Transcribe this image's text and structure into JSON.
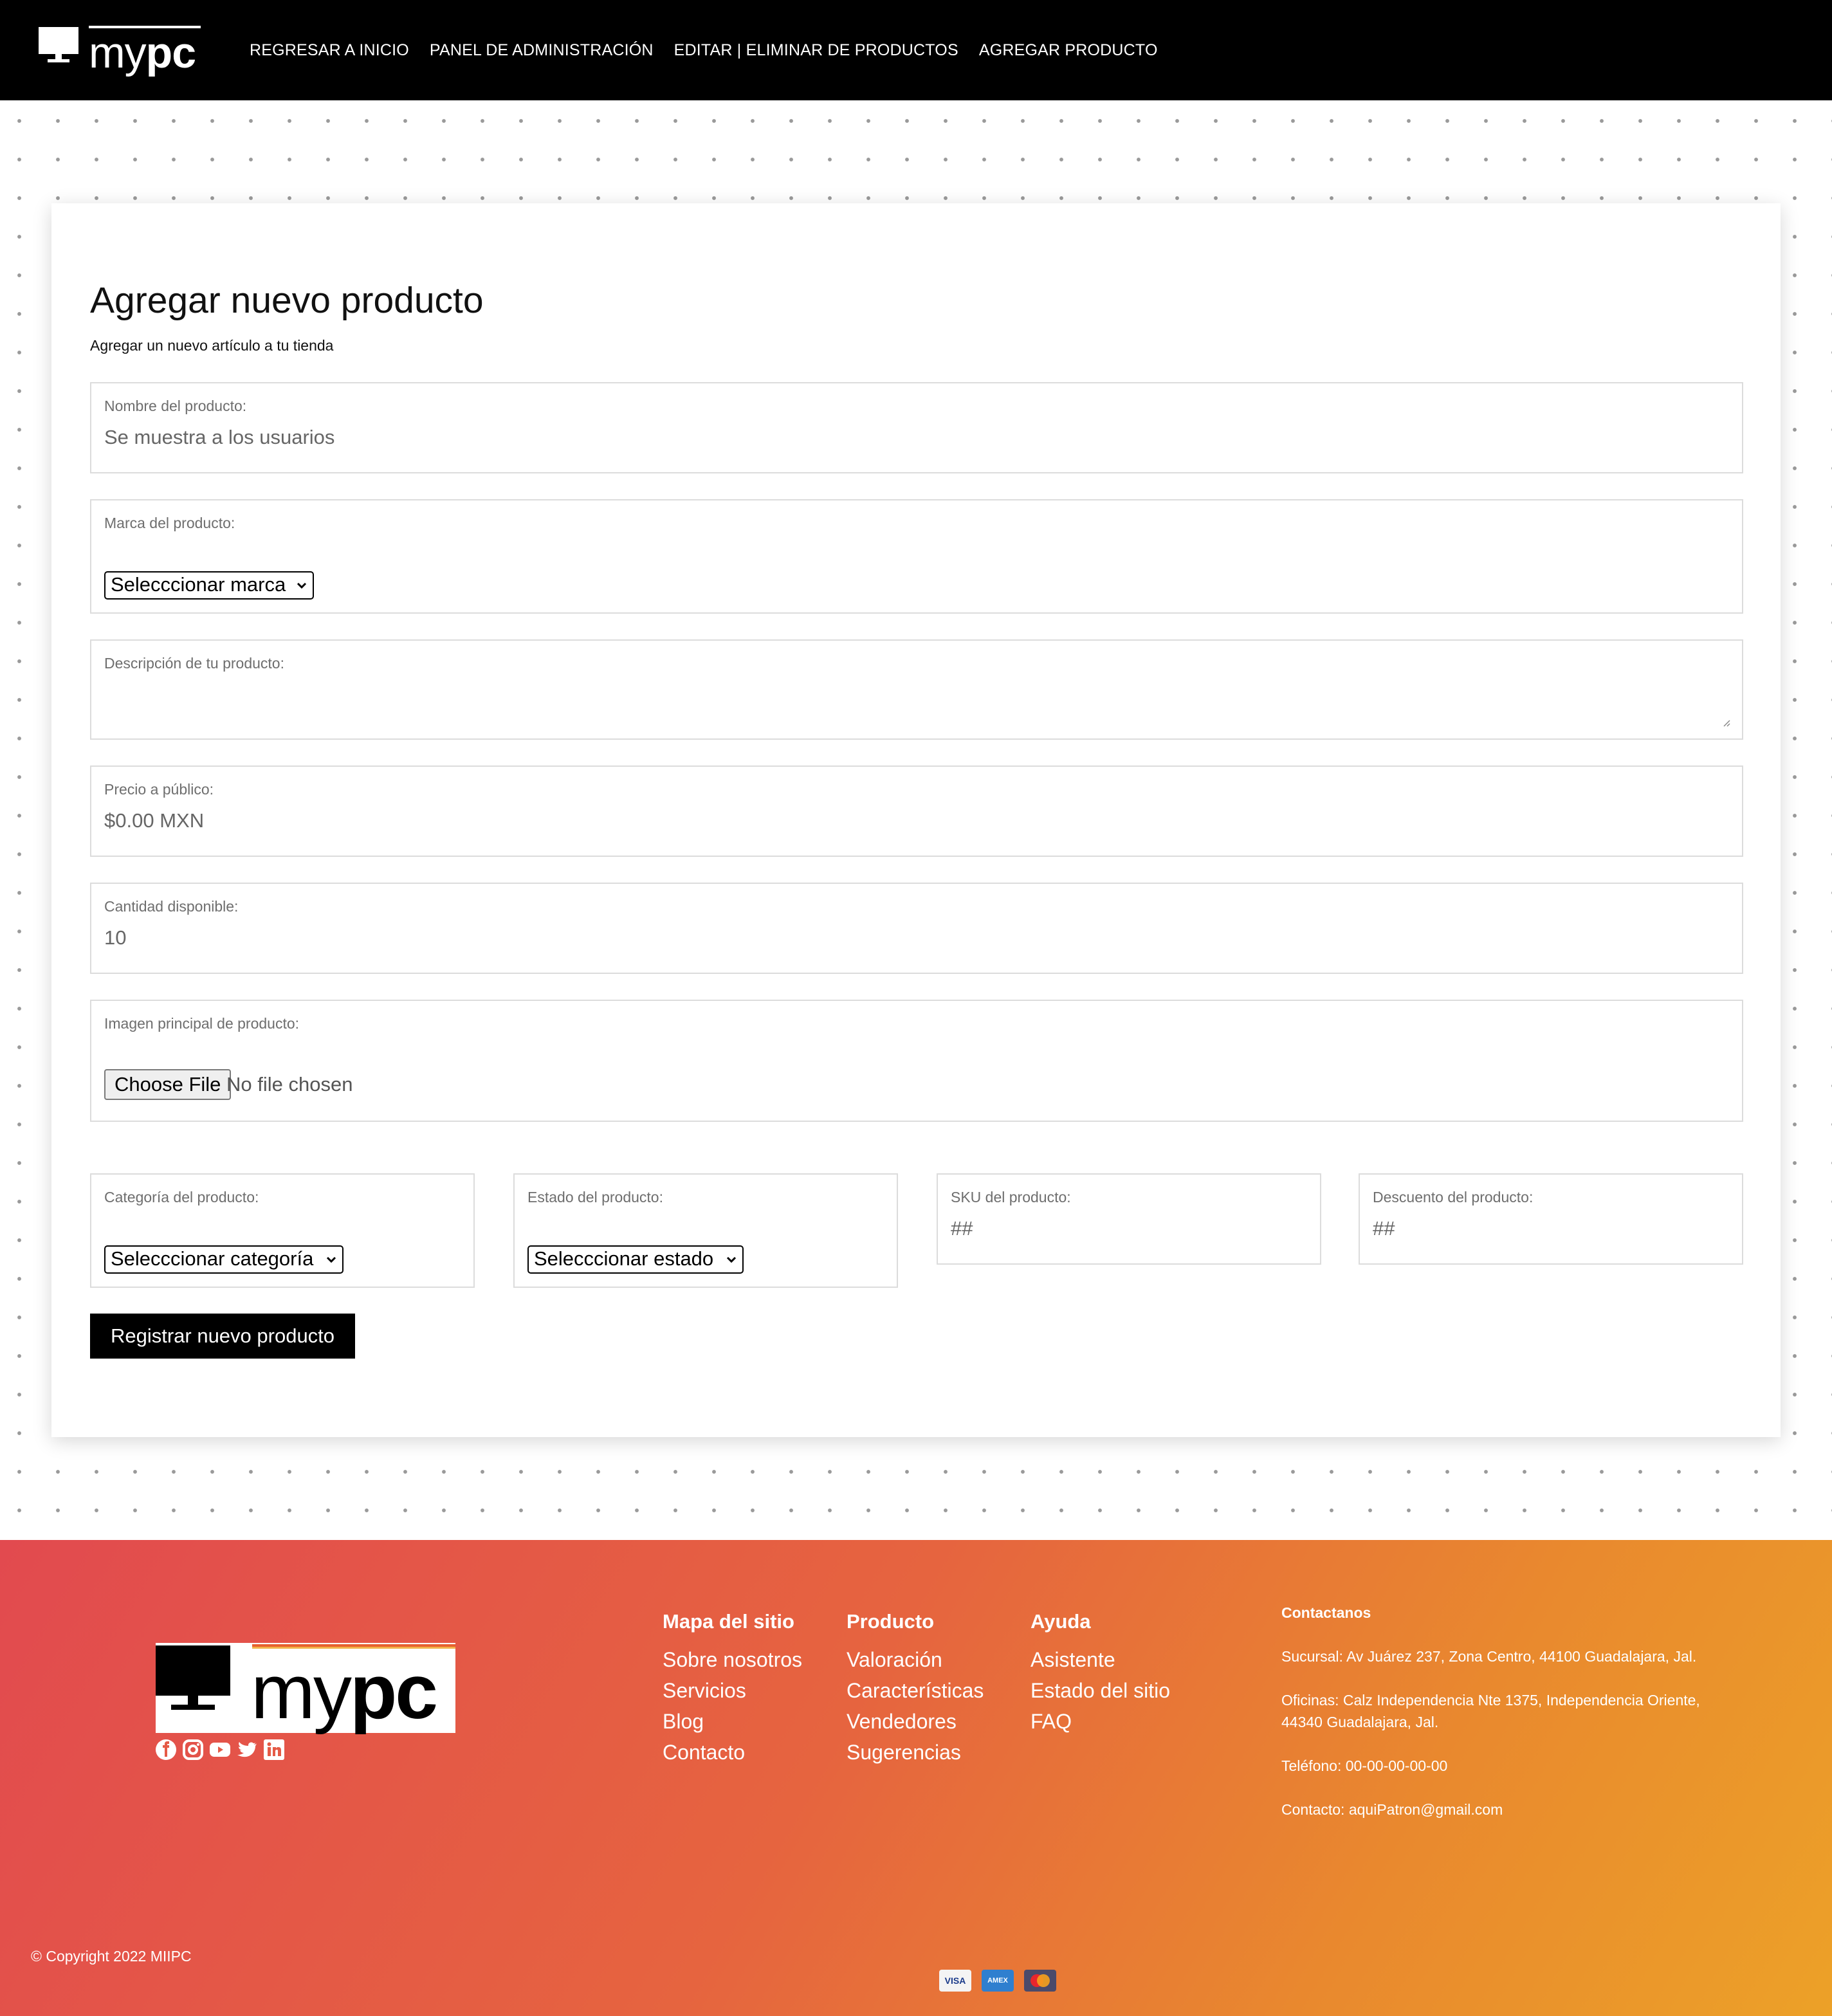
{
  "header": {
    "brand": {
      "my": "my",
      "pc": "pc"
    },
    "nav": [
      "REGRESAR A INICIO",
      "PANEL DE ADMINISTRACIÓN",
      "EDITAR | ELIMINAR DE PRODUCTOS",
      "AGREGAR PRODUCTO"
    ]
  },
  "form": {
    "title": "Agregar nuevo producto",
    "subtitle": "Agregar un nuevo artículo a tu tienda",
    "name": {
      "label": "Nombre del producto:",
      "placeholder": "Se muestra a los usuarios"
    },
    "brand": {
      "label": "Marca del producto:",
      "selected": "Selecccionar marca"
    },
    "description": {
      "label": "Descripción de tu producto:"
    },
    "price": {
      "label": "Precio a público:",
      "placeholder": "$0.00 MXN"
    },
    "quantity": {
      "label": "Cantidad disponible:",
      "placeholder": "10"
    },
    "image": {
      "label": "Imagen principal de producto:",
      "button": "Choose File",
      "status": "No file chosen"
    },
    "category": {
      "label": "Categoría del producto:",
      "selected": "Selecccionar categoría"
    },
    "state": {
      "label": "Estado del producto:",
      "selected": "Selecccionar estado"
    },
    "sku": {
      "label": "SKU del producto:",
      "placeholder": "##"
    },
    "discount": {
      "label": "Descuento del producto:",
      "placeholder": "##"
    },
    "submit": "Registrar nuevo producto"
  },
  "footer": {
    "logo": {
      "my": "my",
      "pc": "pc"
    },
    "socials": [
      "facebook-icon",
      "instagram-icon",
      "youtube-icon",
      "twitter-icon",
      "linkedin-icon"
    ],
    "columns": [
      {
        "title": "Mapa del sitio",
        "links": [
          "Sobre nosotros",
          "Servicios",
          "Blog",
          "Contacto"
        ]
      },
      {
        "title": "Producto",
        "links": [
          "Valoración",
          "Características",
          "Vendedores",
          "Sugerencias"
        ]
      },
      {
        "title": "Ayuda",
        "links": [
          "Asistente",
          "Estado del sitio",
          "FAQ"
        ]
      }
    ],
    "contact": {
      "title": "Contactanos",
      "lines": [
        "Sucursal: Av Juárez 237, Zona Centro, 44100 Guadalajara, Jal.",
        "Oficinas: Calz Independencia Nte 1375, Independencia Oriente, 44340 Guadalajara, Jal.",
        "Teléfono: 00-00-00-00-00",
        "Contacto: aquiPatron@gmail.com"
      ]
    },
    "copyright": "© Copyright 2022 MIIPC",
    "payment_cards": [
      "VISA",
      "AMEX",
      "MC"
    ],
    "gradient": [
      "#e24a4f",
      "#e6643f",
      "#e9892e",
      "#eca128"
    ]
  }
}
